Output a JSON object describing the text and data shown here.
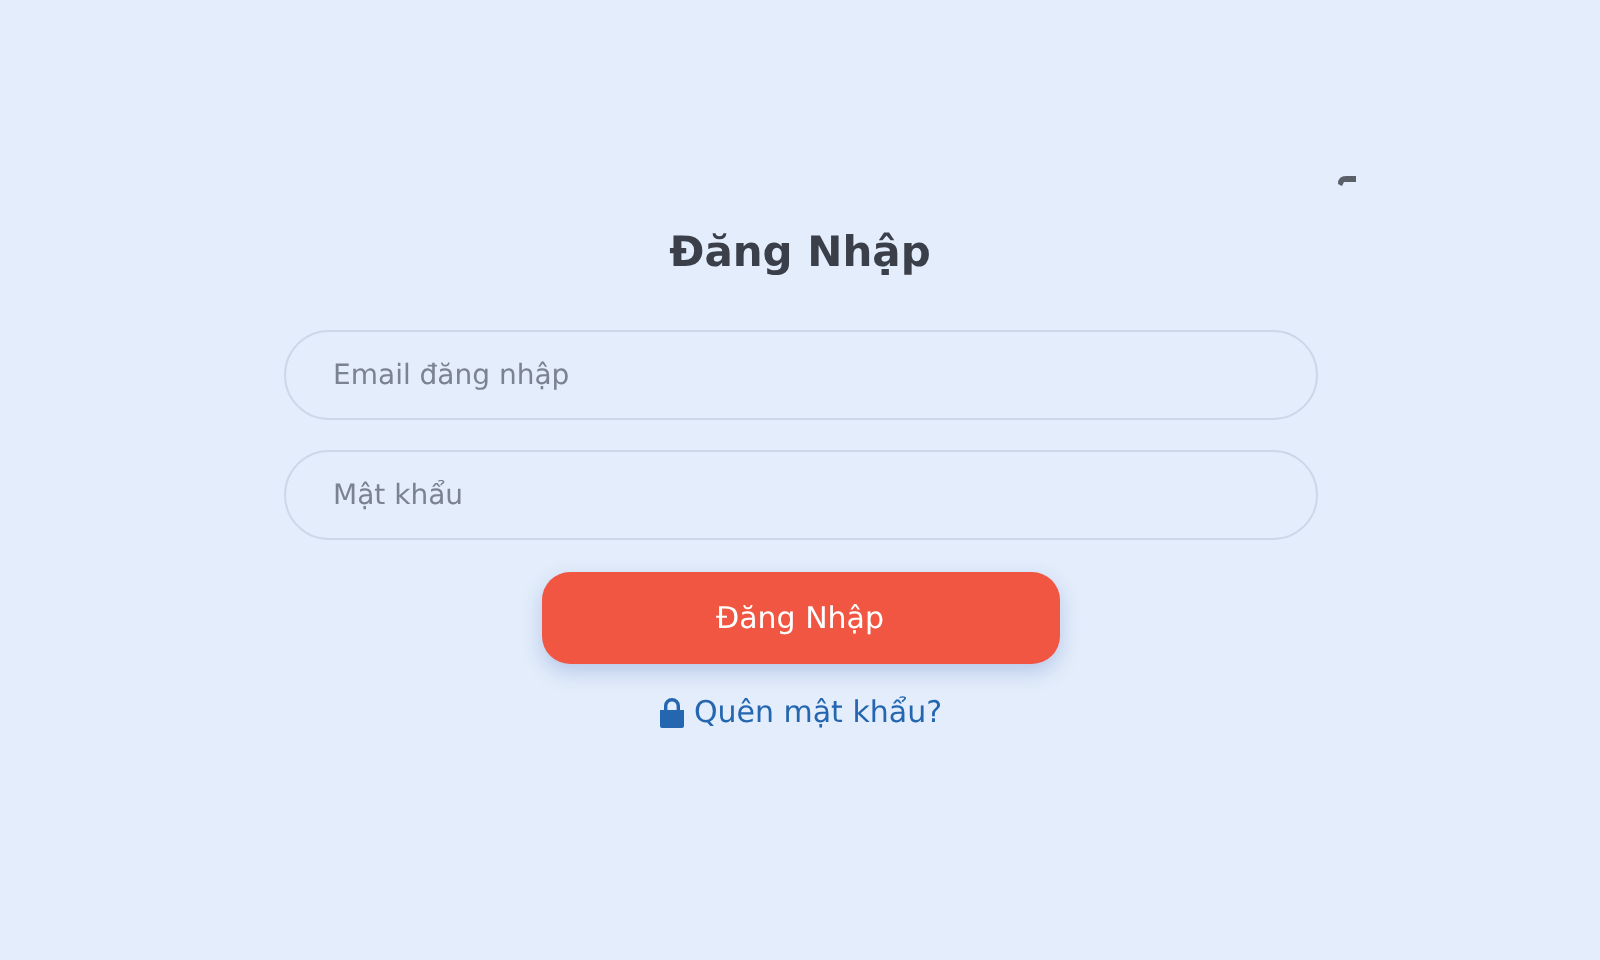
{
  "title": "Đăng Nhập",
  "fields": [
    {
      "placeholder": "Email đăng nhập"
    },
    {
      "placeholder": "Mật khẩu"
    }
  ],
  "submit": {
    "label": "Đăng Nhập"
  },
  "forgot_link": {
    "label": "Quên mật khẩu?"
  }
}
